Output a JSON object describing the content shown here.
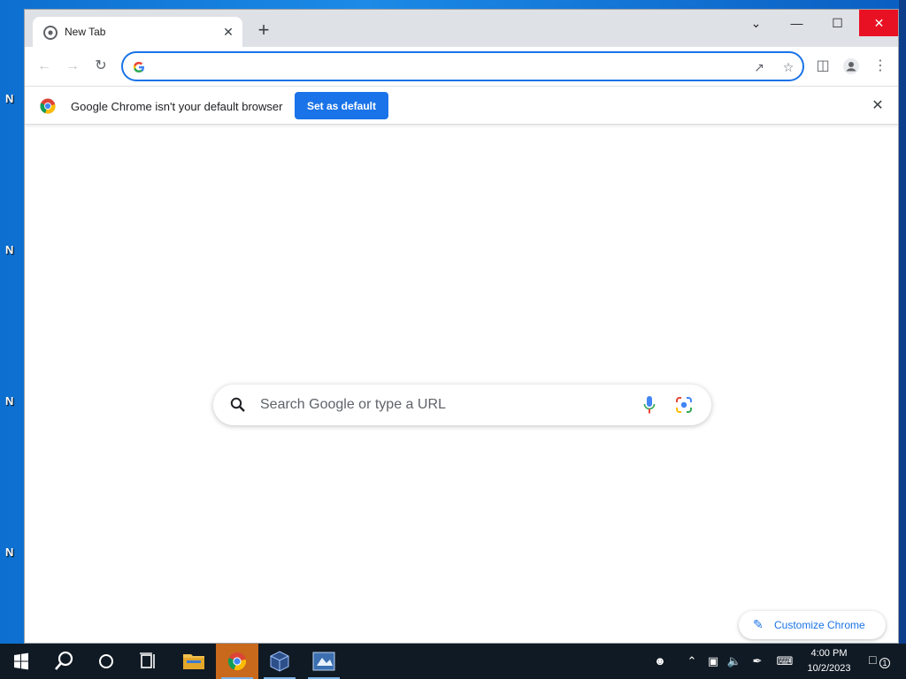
{
  "desktop": {
    "icon_letters": [
      "N",
      "N",
      "N",
      "N"
    ]
  },
  "browser": {
    "tab": {
      "title": "New Tab",
      "close": "✕"
    },
    "new_tab": "+",
    "window_controls": {
      "dropdown": "⌄",
      "minimize": "—",
      "maximize": "☐",
      "close": "✕"
    },
    "omnibox": {
      "value": "",
      "placeholder": ""
    },
    "infobar": {
      "message": "Google Chrome isn't your default browser",
      "button": "Set as default",
      "close": "✕"
    },
    "ntp": {
      "search_placeholder": "Search Google or type a URL",
      "customize_label": "Customize Chrome"
    }
  },
  "taskbar": {
    "clock_time": "4:00 PM",
    "clock_date": "10/2/2023",
    "notification_count": "1"
  },
  "colors": {
    "accent": "#1a73e8",
    "close_red": "#e81123",
    "taskbar": "#101a24"
  }
}
